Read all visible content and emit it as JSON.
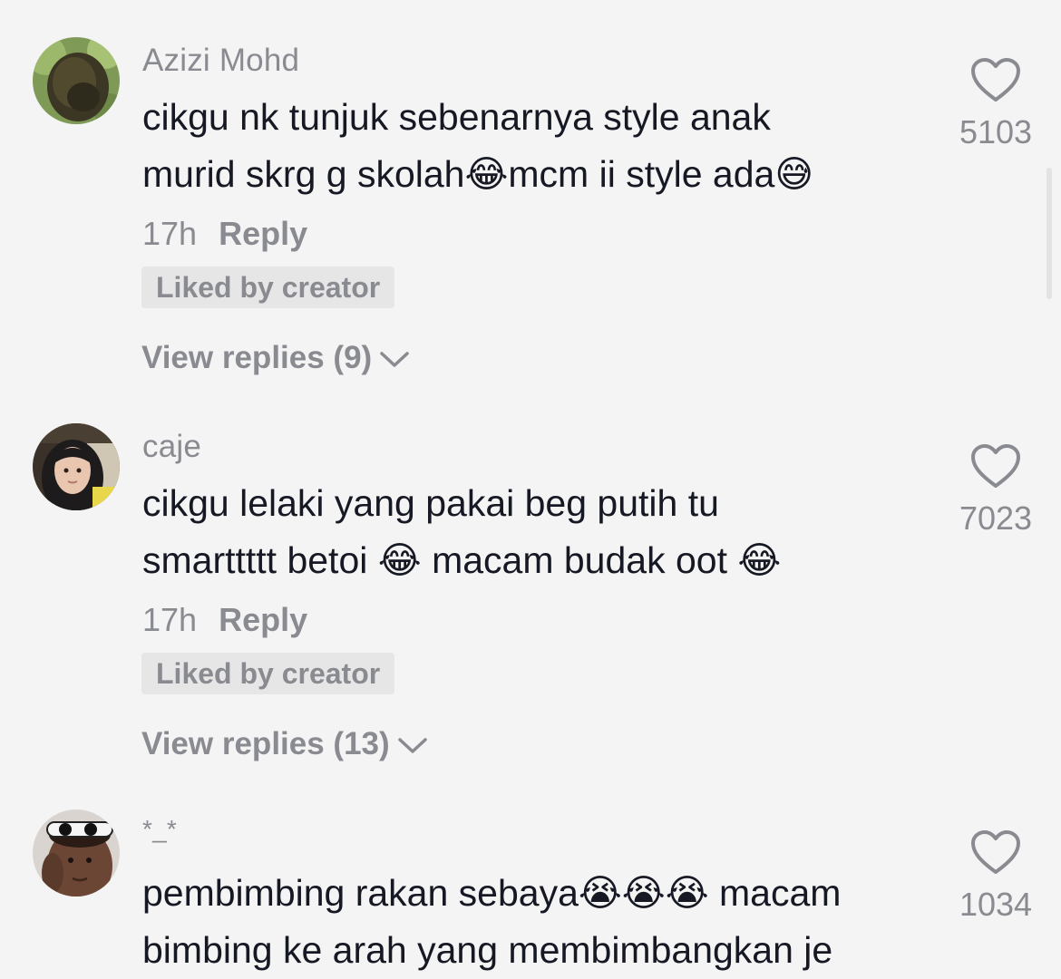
{
  "comments": [
    {
      "username": "Azizi Mohd",
      "text_line1": "cikgu nk tunjuk sebenarnya style anak",
      "text_line2_a": "murid skrg g skolah",
      "emoji_a": "😂",
      "text_line2_b": "mcm ii style ada",
      "emoji_b": "😅",
      "time": "17h",
      "reply_label": "Reply",
      "liked_by_creator": "Liked by creator",
      "view_replies": "View replies (9)",
      "likes": "5103",
      "avatar_icon": "beehive-avatar"
    },
    {
      "username": "caje",
      "text_line1": "cikgu lelaki yang pakai beg putih tu",
      "text_line2_a": "smarttttt betoi ",
      "emoji_a": "😂",
      "text_line2_b": " macam budak oot ",
      "emoji_b": "😂",
      "time": "17h",
      "reply_label": "Reply",
      "liked_by_creator": "Liked by creator",
      "view_replies": "View replies (13)",
      "likes": "7023",
      "avatar_icon": "hijab-person-avatar"
    },
    {
      "username": "*_*",
      "text_line1_a": "pembimbing rakan sebaya",
      "emojis": "😭😭😭",
      "text_line1_b": " macam",
      "text_line2": "bimbing ke arah yang membimbangkan je",
      "likes": "1034",
      "avatar_icon": "person-sunglasses-avatar"
    }
  ],
  "colors": {
    "background": "#f4f4f4",
    "primary_text": "#161823",
    "secondary_text": "#8a8b91",
    "badge_bg": "#e6e6e6"
  },
  "icons": {
    "like": "heart-outline-icon",
    "expand": "chevron-down-icon"
  }
}
